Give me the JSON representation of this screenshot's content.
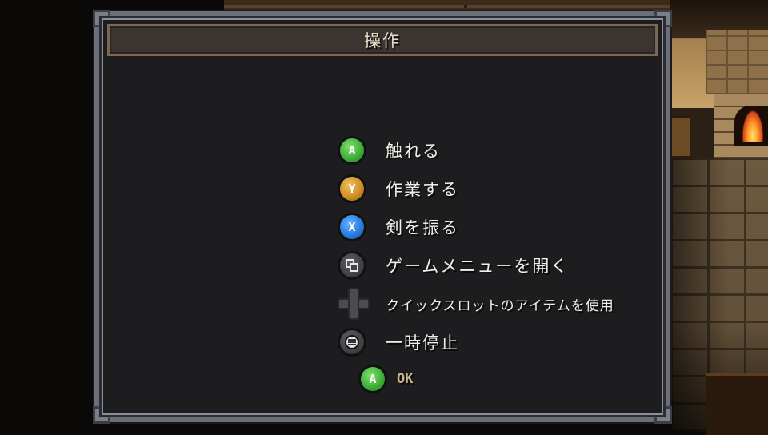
{
  "dialog": {
    "title": "操作"
  },
  "controls": [
    {
      "button": "A",
      "icon": "a-button-icon",
      "color": "#3fb03a",
      "action": "触れる"
    },
    {
      "button": "Y",
      "icon": "y-button-icon",
      "color": "#cf902a",
      "action": "作業する"
    },
    {
      "button": "X",
      "icon": "x-button-icon",
      "color": "#2a7ee0",
      "action": "剣を振る"
    },
    {
      "button": "view",
      "icon": "view-button-icon",
      "color": "#414146",
      "action": "ゲームメニューを開く"
    },
    {
      "button": "dpad",
      "icon": "dpad-icon",
      "color": "#4b4b50",
      "action": "クイックスロットのアイテムを使用"
    },
    {
      "button": "menu",
      "icon": "menu-button-icon",
      "color": "#414146",
      "action": "一時停止"
    }
  ],
  "confirm": {
    "button": "A",
    "label": "OK"
  }
}
